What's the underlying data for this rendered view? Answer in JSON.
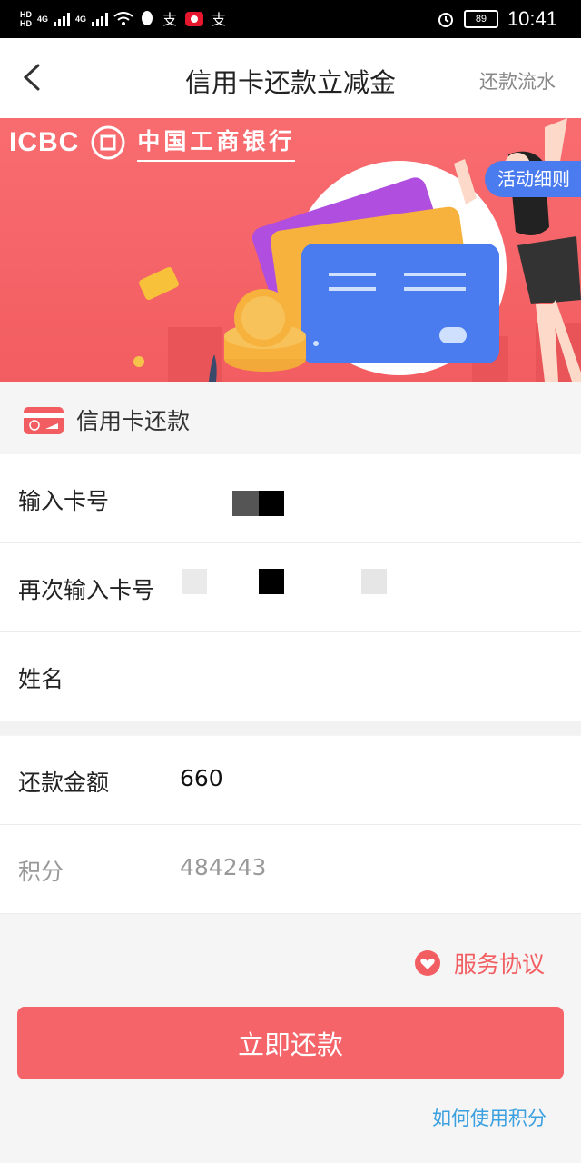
{
  "status_bar": {
    "hd1": "HD",
    "hd2": "HD",
    "net1": "4G",
    "net2": "4G",
    "battery": "89",
    "time": "10:41"
  },
  "header": {
    "title": "信用卡还款立减金",
    "right_link": "还款流水"
  },
  "banner": {
    "icbc_text": "ICBC",
    "bank_name": "中国工商银行",
    "rules_button": "活动细则"
  },
  "section": {
    "title": "信用卡还款"
  },
  "form": {
    "card_number_label": "输入卡号",
    "card_number_confirm_label": "再次输入卡号",
    "name_label": "姓名",
    "amount_label": "还款金额",
    "amount_value": "660",
    "points_label": "积分",
    "points_value": "484243"
  },
  "agreement": {
    "label": "服务协议"
  },
  "submit_label": "立即还款",
  "howto_link": "如何使用积分",
  "colors": {
    "accent": "#f25d61",
    "link": "#3ba0e0",
    "rules_bg": "#4a7cf0"
  }
}
